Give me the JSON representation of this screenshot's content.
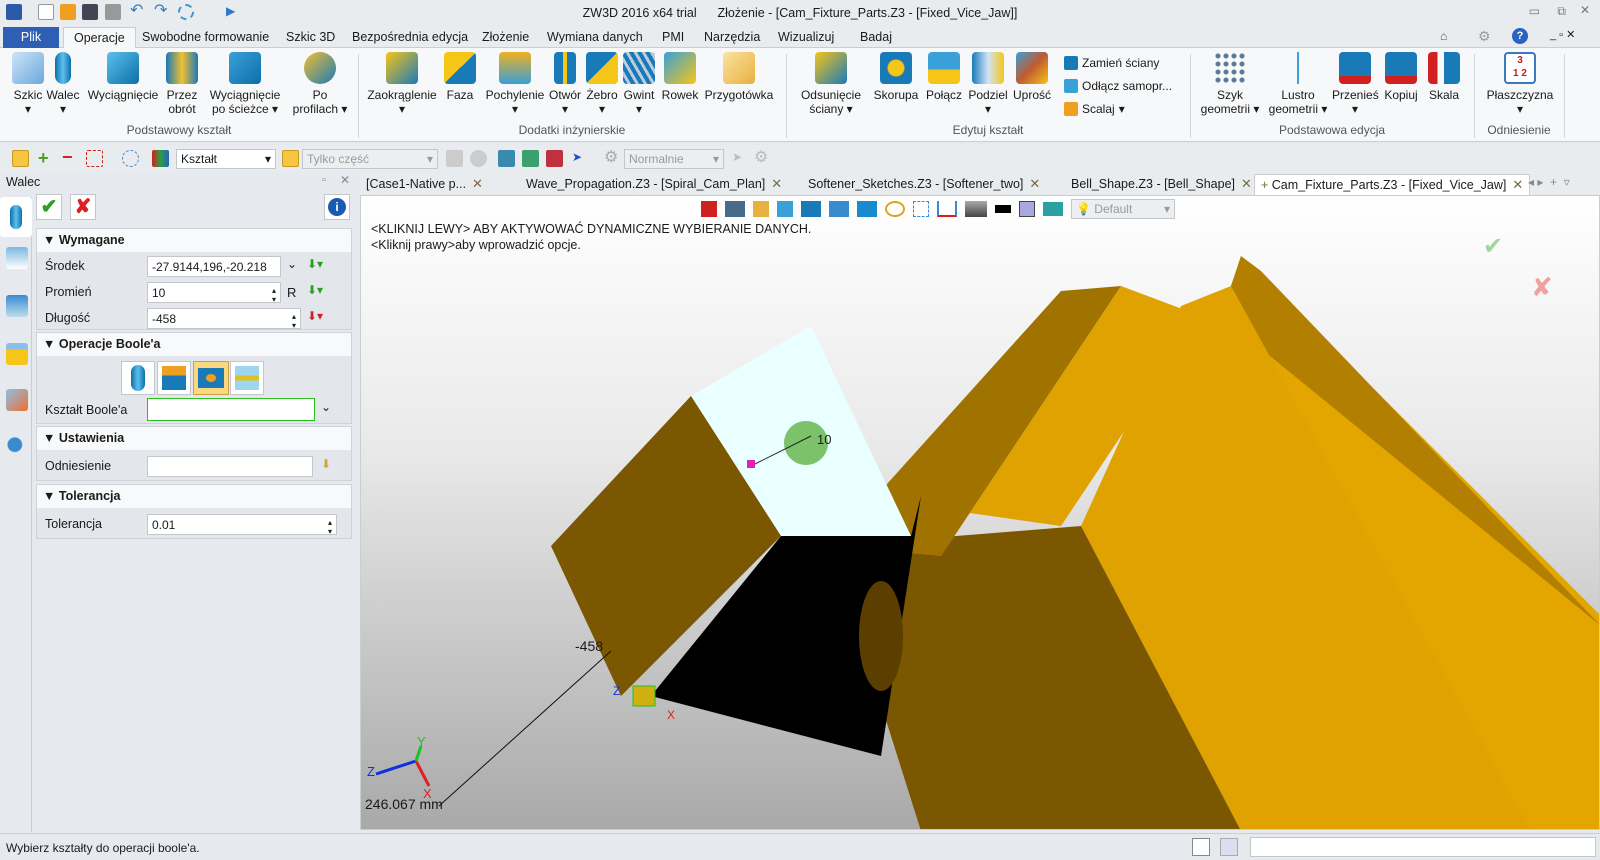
{
  "window": {
    "app": "ZW3D 2016  x64 trial",
    "doc": "Złożenie - [Cam_Fixture_Parts.Z3 - [Fixed_Vice_Jaw]]"
  },
  "menu": [
    "Plik",
    "Operacje",
    "Swobodne formowanie",
    "Szkic 3D",
    "Bezpośrednia edycja",
    "Złożenie",
    "Wymiana danych",
    "PMI",
    "Narzędzia",
    "Wizualizuj",
    "Badaj"
  ],
  "ribbon": {
    "groups": [
      "Podstawowy kształt",
      "Dodatki inżynierskie",
      "Edytuj kształt",
      "Podstawowa edycja",
      "Odniesienie"
    ],
    "buttons": [
      "Szkic",
      "Walec",
      "Wyciągnięcie",
      "Przez obrót",
      "Wyciągnięcie po ścieżce",
      "Po profilach",
      "Zaokrąglenie",
      "Faza",
      "Pochylenie",
      "Otwór",
      "Żebro",
      "Gwint",
      "Rowek",
      "Przygotówka",
      "Odsunięcie ściany",
      "Skorupa",
      "Połącz",
      "Podziel",
      "Uprość",
      "Szyk geometrii",
      "Lustro geometrii",
      "Przenieś",
      "Kopiuj",
      "Skala",
      "Płaszczyzna"
    ],
    "small": [
      "Zamień ściany",
      "Odłącz samopr...",
      "Scalaj"
    ]
  },
  "toolbar": {
    "filter": "Kształt",
    "scope": "Tylko część",
    "mode": "Normalnie"
  },
  "panel": {
    "title": "Walec",
    "sections": {
      "required": "Wymagane",
      "boolean": "Operacje Boole'a",
      "settings": "Ustawienia",
      "tolerance": "Tolerancja"
    },
    "fields": {
      "center_label": "Środek",
      "center": "-27.9144,196,-20.218",
      "radius_label": "Promień",
      "radius": "10",
      "radius_suffix": "R",
      "length_label": "Długość",
      "length": "-458",
      "bool_shape_label": "Kształt Boole'a",
      "bool_shape": "",
      "ref_label": "Odniesienie",
      "ref": "",
      "tol_label": "Tolerancja",
      "tol": "0.01"
    }
  },
  "doctabs": [
    "[Case1-Native p...",
    "Wave_Propagation.Z3 - [Spiral_Cam_Plan]",
    "Softener_Sketches.Z3 - [Softener_two]",
    "Bell_Shape.Z3 - [Bell_Shape]",
    "Cam_Fixture_Parts.Z3 - [Fixed_Vice_Jaw]"
  ],
  "viewport": {
    "prompt1": "<KLIKNIJ LEWY> ABY AKTYWOWAĆ DYNAMICZNE WYBIERANIE DANYCH.",
    "prompt2": "<Kliknij prawy>aby wprowadzić opcje.",
    "style": "Default",
    "dim_radius": "10",
    "dim_length": "-458",
    "distance": "246.067 mm",
    "axes": {
      "x": "X",
      "y": "Y",
      "z": "Z"
    }
  },
  "status": {
    "message": "Wybierz kształty do operacji boole'a."
  },
  "colors": {
    "part": "#e2a400",
    "accent": "#2e5fb4"
  }
}
